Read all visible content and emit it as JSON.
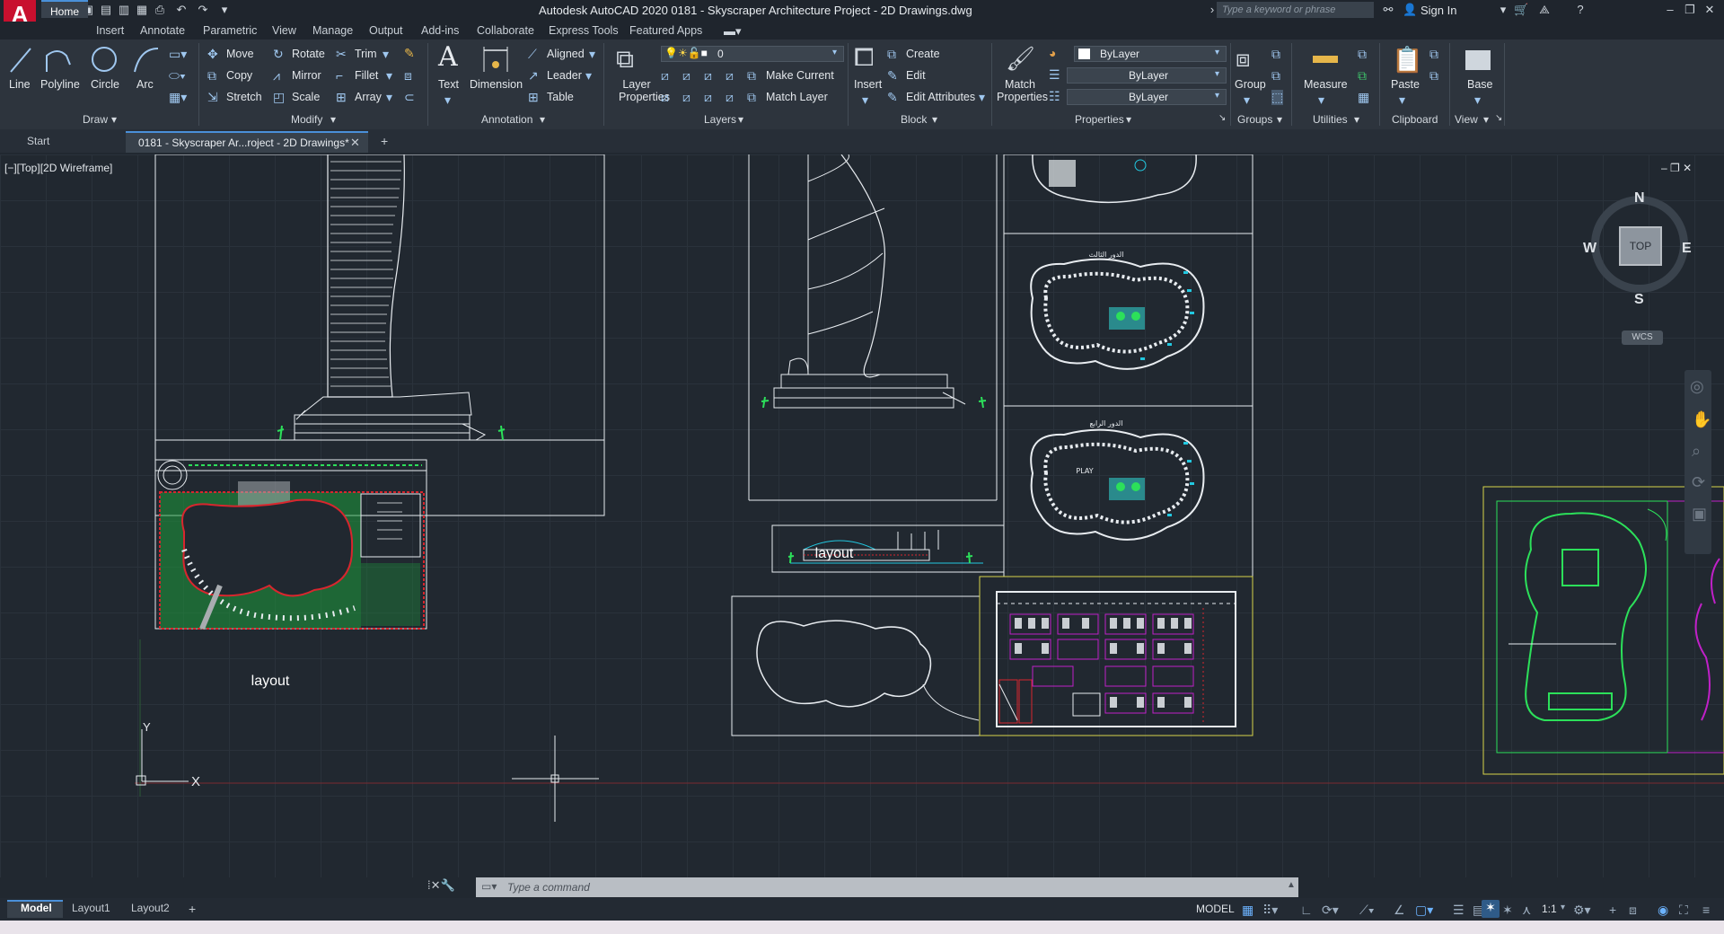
{
  "app": {
    "title": "Autodesk AutoCAD 2020    0181 - Skyscraper Architecture Project - 2D Drawings.dwg",
    "logo": "A",
    "search_placeholder": "Type a keyword or phrase",
    "sign_in": "Sign In"
  },
  "menu_tabs": [
    "Home",
    "Insert",
    "Annotate",
    "Parametric",
    "View",
    "Manage",
    "Output",
    "Add-ins",
    "Collaborate",
    "Express Tools",
    "Featured Apps"
  ],
  "ribbon": {
    "draw": {
      "title": "Draw",
      "line": "Line",
      "polyline": "Polyline",
      "circle": "Circle",
      "arc": "Arc"
    },
    "modify": {
      "title": "Modify",
      "move": "Move",
      "rotate": "Rotate",
      "trim": "Trim",
      "copy": "Copy",
      "mirror": "Mirror",
      "fillet": "Fillet",
      "stretch": "Stretch",
      "scale": "Scale",
      "array": "Array"
    },
    "annotation": {
      "title": "Annotation",
      "text": "Text",
      "dimension": "Dimension",
      "aligned": "Aligned",
      "leader": "Leader",
      "table": "Table"
    },
    "layers": {
      "title": "Layers",
      "layer_properties": "Layer Properties",
      "current_layer": "0",
      "make_current": "Make Current",
      "match_layer": "Match Layer"
    },
    "block": {
      "title": "Block",
      "insert": "Insert",
      "create": "Create",
      "edit": "Edit",
      "edit_attributes": "Edit Attributes"
    },
    "properties": {
      "title": "Properties",
      "match_properties": "Match Properties",
      "color": "ByLayer",
      "linetype": "ByLayer",
      "lineweight": "ByLayer"
    },
    "groups": {
      "title": "Groups",
      "group": "Group"
    },
    "utilities": {
      "title": "Utilities",
      "measure": "Measure"
    },
    "clipboard": {
      "title": "Clipboard",
      "paste": "Paste"
    },
    "view": {
      "title": "View",
      "base": "Base"
    }
  },
  "doc_tabs": {
    "start": "Start",
    "active": "0181 - Skyscraper Ar...roject - 2D Drawings*",
    "add": "+"
  },
  "viewport": {
    "label": "[−][Top][2D Wireframe]",
    "viewcube": {
      "n": "N",
      "s": "S",
      "e": "E",
      "w": "W",
      "face": "TOP",
      "wcs": "WCS"
    },
    "layout_label_1": "layout",
    "layout_label_2": "layout",
    "play": "PLAY",
    "arabic_3": "الدور الثالث",
    "arabic_4": "الدور الرابع",
    "ucs_y": "Y",
    "ucs_x": "X"
  },
  "command": {
    "placeholder": "Type a command"
  },
  "layout_tabs": [
    "Model",
    "Layout1",
    "Layout2"
  ],
  "status": {
    "model": "MODEL",
    "scale": "1:1"
  },
  "colors": {
    "accent": "#4a90d9",
    "logo": "#c8102e",
    "drawing_white": "#e8ecf0",
    "hatch_green": "#1e9b3c",
    "bright_green": "#2ce05a",
    "yellow": "#d6d34a",
    "red": "#d8262e",
    "magenta": "#c020c8",
    "cyan": "#22c8e0"
  }
}
